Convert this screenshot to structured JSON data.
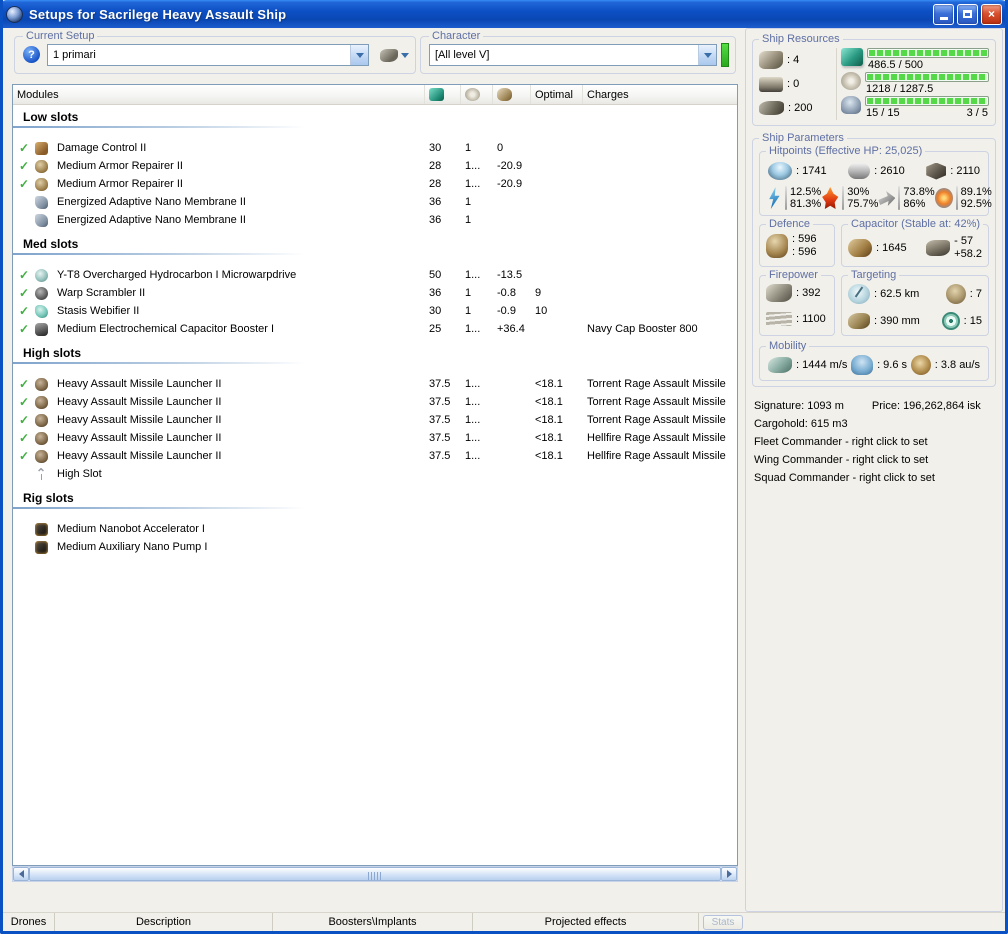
{
  "window": {
    "title": "Setups for Sacrilege Heavy Assault Ship"
  },
  "current_setup": {
    "label": "Current Setup",
    "value": "1 primari"
  },
  "character": {
    "label": "Character",
    "value": "[All level V]"
  },
  "modules_table": {
    "header": {
      "modules": "Modules",
      "optimal": "Optimal",
      "charges": "Charges"
    },
    "fitted_glyph": "✓",
    "columns": [
      "cpu",
      "powergrid",
      "capacitor"
    ],
    "sections": [
      {
        "title": "Low slots",
        "rows": [
          {
            "fitted": true,
            "icon": "damage-control",
            "name": "Damage Control II",
            "cpu": "30",
            "pg": "1",
            "cap": "0",
            "optimal": "",
            "charges": ""
          },
          {
            "fitted": true,
            "icon": "armor-repairer",
            "name": "Medium Armor Repairer II",
            "cpu": "28",
            "pg": "1...",
            "cap": "-20.9",
            "optimal": "",
            "charges": ""
          },
          {
            "fitted": true,
            "icon": "armor-repairer",
            "name": "Medium Armor Repairer II",
            "cpu": "28",
            "pg": "1...",
            "cap": "-20.9",
            "optimal": "",
            "charges": ""
          },
          {
            "fitted": false,
            "icon": "nano-membrane",
            "name": "Energized Adaptive Nano Membrane II",
            "cpu": "36",
            "pg": "1",
            "cap": "",
            "optimal": "",
            "charges": ""
          },
          {
            "fitted": false,
            "icon": "nano-membrane",
            "name": "Energized Adaptive Nano Membrane II",
            "cpu": "36",
            "pg": "1",
            "cap": "",
            "optimal": "",
            "charges": ""
          }
        ]
      },
      {
        "title": "Med slots",
        "rows": [
          {
            "fitted": true,
            "icon": "mwd",
            "name": "Y-T8 Overcharged Hydrocarbon I Microwarpdrive",
            "cpu": "50",
            "pg": "1...",
            "cap": "-13.5",
            "optimal": "",
            "charges": ""
          },
          {
            "fitted": true,
            "icon": "warp-scrambler",
            "name": "Warp Scrambler II",
            "cpu": "36",
            "pg": "1",
            "cap": "-0.8",
            "optimal": "9",
            "charges": ""
          },
          {
            "fitted": true,
            "icon": "stasis-webifier",
            "name": "Stasis Webifier II",
            "cpu": "30",
            "pg": "1",
            "cap": "-0.9",
            "optimal": "10",
            "charges": ""
          },
          {
            "fitted": true,
            "icon": "cap-booster",
            "name": "Medium Electrochemical Capacitor Booster I",
            "cpu": "25",
            "pg": "1...",
            "cap": "+36.4",
            "optimal": "",
            "charges": "Navy Cap Booster 800"
          }
        ]
      },
      {
        "title": "High slots",
        "rows": [
          {
            "fitted": true,
            "icon": "missile-launcher",
            "name": "Heavy Assault Missile Launcher II",
            "cpu": "37.5",
            "pg": "1...",
            "cap": "",
            "optimal": "<18.1",
            "charges": "Torrent Rage Assault Missile"
          },
          {
            "fitted": true,
            "icon": "missile-launcher",
            "name": "Heavy Assault Missile Launcher II",
            "cpu": "37.5",
            "pg": "1...",
            "cap": "",
            "optimal": "<18.1",
            "charges": "Torrent Rage Assault Missile"
          },
          {
            "fitted": true,
            "icon": "missile-launcher",
            "name": "Heavy Assault Missile Launcher II",
            "cpu": "37.5",
            "pg": "1...",
            "cap": "",
            "optimal": "<18.1",
            "charges": "Torrent Rage Assault Missile"
          },
          {
            "fitted": true,
            "icon": "missile-launcher",
            "name": "Heavy Assault Missile Launcher II",
            "cpu": "37.5",
            "pg": "1...",
            "cap": "",
            "optimal": "<18.1",
            "charges": "Hellfire Rage Assault Missile"
          },
          {
            "fitted": true,
            "icon": "missile-launcher",
            "name": "Heavy Assault Missile Launcher II",
            "cpu": "37.5",
            "pg": "1...",
            "cap": "",
            "optimal": "<18.1",
            "charges": "Hellfire Rage Assault Missile"
          },
          {
            "fitted": false,
            "icon": "empty-high-slot",
            "name": "High Slot",
            "cpu": "",
            "pg": "",
            "cap": "",
            "optimal": "",
            "charges": ""
          }
        ]
      },
      {
        "title": "Rig slots",
        "rows": [
          {
            "fitted": false,
            "icon": "rig",
            "name": "Medium Nanobot Accelerator I",
            "cpu": "",
            "pg": "",
            "cap": "",
            "optimal": "",
            "charges": ""
          },
          {
            "fitted": false,
            "icon": "rig",
            "name": "Medium Auxiliary Nano Pump I",
            "cpu": "",
            "pg": "",
            "cap": "",
            "optimal": "",
            "charges": ""
          }
        ]
      }
    ]
  },
  "tabs": [
    "Drones",
    "Description",
    "Boosters\\Implants",
    "Projected effects"
  ],
  "stats_button": "Stats",
  "ship_resources": {
    "label": "Ship Resources",
    "turret_hardpoints": ": 4",
    "launcher_hardpoints": ": 0",
    "drone_capacity": ": 200",
    "cpu_text": "486.5 / 500",
    "powergrid_text": "1218 / 1287.5",
    "calibration_text": "15 / 15",
    "rig_slots_text": "3 / 5"
  },
  "ship_parameters": {
    "label": "Ship Parameters",
    "hitpoints": {
      "label": "Hitpoints (Effective HP: 25,025)",
      "shield": ": 1741",
      "armor": ": 2610",
      "structure": ": 2110",
      "resists": [
        {
          "name": "em",
          "top": "12.5%",
          "bottom": "81.3%"
        },
        {
          "name": "thermal",
          "top": "30%",
          "bottom": "75.7%"
        },
        {
          "name": "kinetic",
          "top": "73.8%",
          "bottom": "86%"
        },
        {
          "name": "explosive",
          "top": "89.1%",
          "bottom": "92.5%"
        }
      ]
    },
    "defence": {
      "label": "Defence",
      "top": ": 596",
      "bottom": ": 596"
    },
    "capacitor": {
      "label": "Capacitor (Stable at: 42%)",
      "amount": ": 1645",
      "delta_top": "- 57",
      "delta_bottom": "+58.2"
    },
    "firepower": {
      "label": "Firepower",
      "dps": ": 392",
      "volley": ": 1100"
    },
    "targeting": {
      "label": "Targeting",
      "range": ": 62.5 km",
      "max_targets": ": 7",
      "scan_res": ": 390 mm",
      "sensor_strength": ": 15"
    },
    "mobility": {
      "label": "Mobility",
      "speed": ": 1444 m/s",
      "align_time": ": 9.6 s",
      "warp_speed": ": 3.8 au/s"
    }
  },
  "info": {
    "signature": "Signature: 1093 m",
    "price": "Price: 196,262,864 isk",
    "cargohold": "Cargohold: 615 m3",
    "fleet": "Fleet Commander - right click to set",
    "wing": "Wing Commander - right click to set",
    "squad": "Squad Commander - right click to set"
  }
}
